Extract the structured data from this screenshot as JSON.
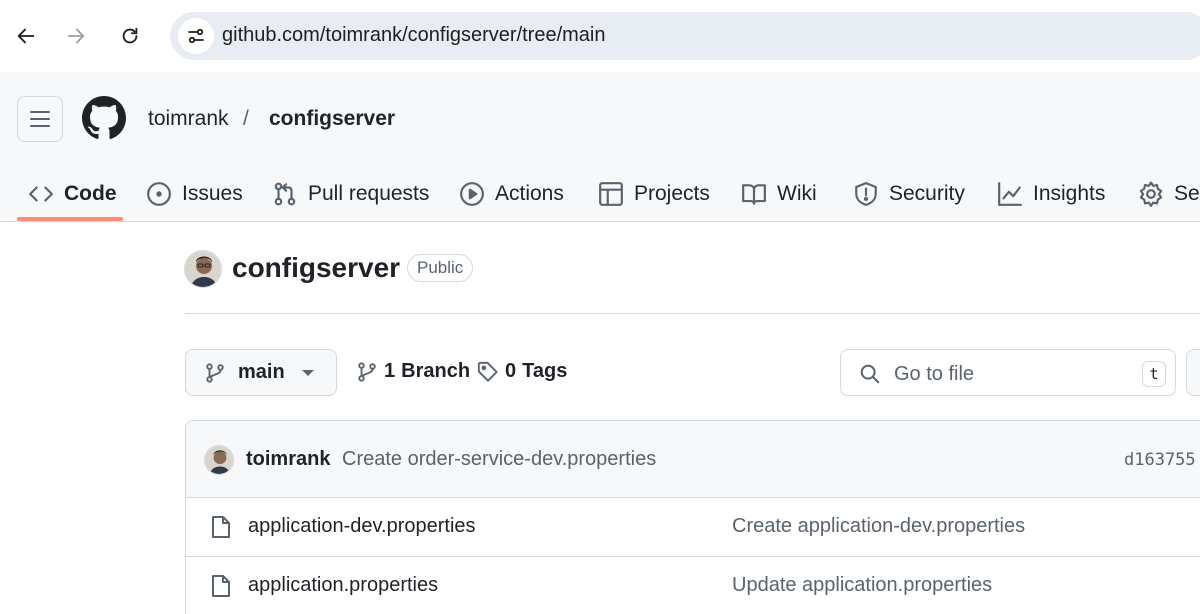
{
  "browser": {
    "url": "github.com/toimrank/configserver/tree/main",
    "icons": [
      "back-arrow-icon",
      "forward-arrow-icon",
      "reload-icon",
      "site-info-icon"
    ]
  },
  "header": {
    "owner": "toimrank",
    "separator": "/",
    "repo": "configserver"
  },
  "tabs": [
    {
      "label": "Code",
      "icon": "code-icon",
      "active": true
    },
    {
      "label": "Issues",
      "icon": "issue-icon"
    },
    {
      "label": "Pull requests",
      "icon": "pull-request-icon"
    },
    {
      "label": "Actions",
      "icon": "play-icon"
    },
    {
      "label": "Projects",
      "icon": "table-icon"
    },
    {
      "label": "Wiki",
      "icon": "book-icon"
    },
    {
      "label": "Security",
      "icon": "shield-icon"
    },
    {
      "label": "Insights",
      "icon": "graph-icon"
    },
    {
      "label": "Se",
      "icon": "gear-icon"
    }
  ],
  "repo": {
    "name": "configserver",
    "visibility": "Public"
  },
  "branch": {
    "current": "main",
    "branch_count": "1",
    "branch_label": "Branch",
    "tag_count": "0",
    "tag_label": "Tags"
  },
  "search": {
    "placeholder": "Go to file",
    "shortcut": "t"
  },
  "latest_commit": {
    "author": "toimrank",
    "message": "Create order-service-dev.properties",
    "sha": "d163755 ·"
  },
  "files": [
    {
      "name": "application-dev.properties",
      "commit": "Create application-dev.properties"
    },
    {
      "name": "application.properties",
      "commit": "Update application.properties"
    }
  ],
  "colors": {
    "accent_underline": "#fd8c73",
    "header_bg": "#f6f8fa",
    "border": "#d1d9e0",
    "url_bar_bg": "#e8ecf3"
  }
}
